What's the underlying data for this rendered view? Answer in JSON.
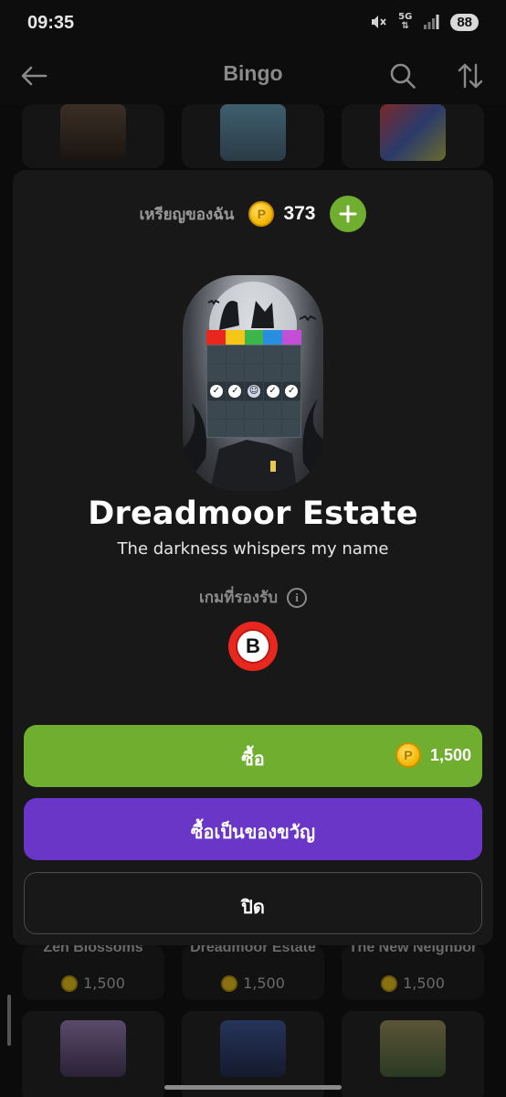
{
  "status_bar": {
    "time": "09:35",
    "network": "5G",
    "battery": "88",
    "icons": [
      "mute-icon",
      "signal-icon"
    ]
  },
  "app_bar": {
    "title": "Bingo",
    "icons": [
      "back-arrow-icon",
      "search-icon",
      "sort-icon"
    ]
  },
  "background_items": [
    {
      "name": "Zen Blossoms",
      "price": "1,500"
    },
    {
      "name": "Dreadmoor Estate",
      "price": "1,500"
    },
    {
      "name": "The New Neighbor",
      "price": "1,500"
    }
  ],
  "modal": {
    "balance_label": "เหรียญของฉัน",
    "balance_value": "373",
    "coin_glyph": "P",
    "item_title": "Dreadmoor Estate",
    "item_subtitle": "The darkness whispers my name",
    "supported_label": "เกมที่รองรับ",
    "supported_game_letter": "B",
    "buy_label": "ซื้อ",
    "buy_price": "1,500",
    "gift_label": "ซื้อเป็นของขวัญ",
    "close_label": "ปิด"
  },
  "colors": {
    "buy": "#6fae2e",
    "gift": "#6a36c8",
    "coin": "#f2b400",
    "badge": "#e8281f"
  }
}
